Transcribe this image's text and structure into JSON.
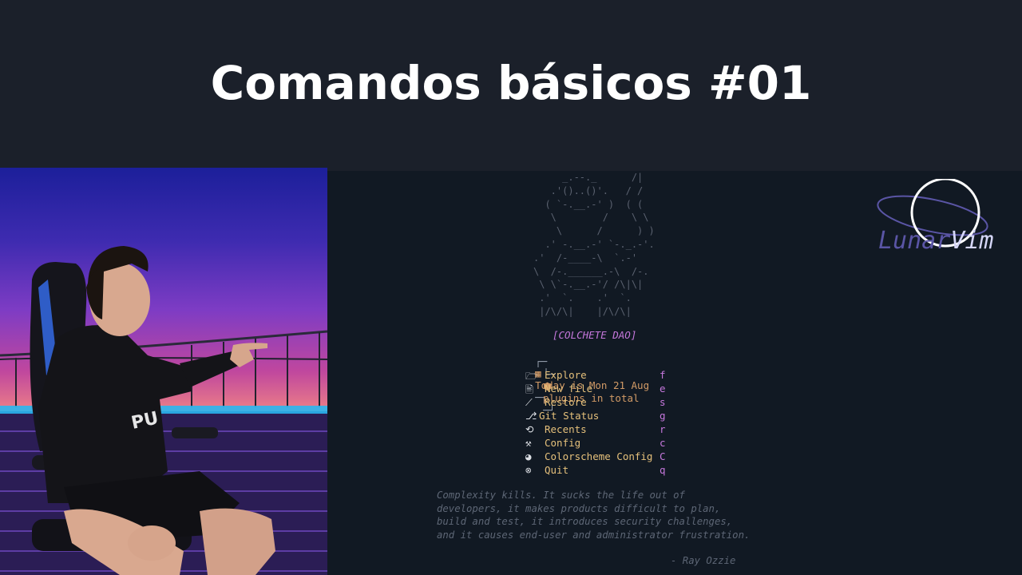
{
  "title": "Comandos básicos #01",
  "dashboard": {
    "ascii_art": "     _.--._      /|\n   .'()..()'.   / /\n  ( `-.__.-' )  ( (\n   \\        /    \\ \\\n    \\      /      ) )\n  .' -.__.-' `-._.-'.\n.'  /-____-\\  `.-'\n\\  /-.______.-\\  /-.\n \\ \\`-.__.-'/ /\\|\\|\n .'  `.    .'  `.\n |/\\/\\|    |/\\/\\|",
    "heading": "[COLCHETE DAO]",
    "date_line": "Today is Mon 21 Aug",
    "plugins_line": "plugins in total",
    "menu": [
      {
        "icon": "🗁",
        "label": "Explore",
        "key": "f"
      },
      {
        "icon": "🖹",
        "label": "New file",
        "key": "e"
      },
      {
        "icon": "⟋",
        "label": "Restore",
        "key": "s"
      },
      {
        "icon": "⎇",
        "label": "Git Status",
        "key": "g"
      },
      {
        "icon": "⟲",
        "label": "Recents",
        "key": "r"
      },
      {
        "icon": "⚒",
        "label": "Config",
        "key": "c"
      },
      {
        "icon": "◕",
        "label": "Colorscheme Config",
        "key": "C"
      },
      {
        "icon": "⊗",
        "label": "Quit",
        "key": "q"
      }
    ],
    "quote": "Complexity kills. It sucks the life out of\ndevelopers, it makes products difficult to plan,\nbuild and test, it introduces security challenges,\nand it causes end-user and administrator frustration.",
    "quote_author": "- Ray Ozzie"
  },
  "logo": {
    "part1": "Lunar",
    "part2": "Vim"
  }
}
